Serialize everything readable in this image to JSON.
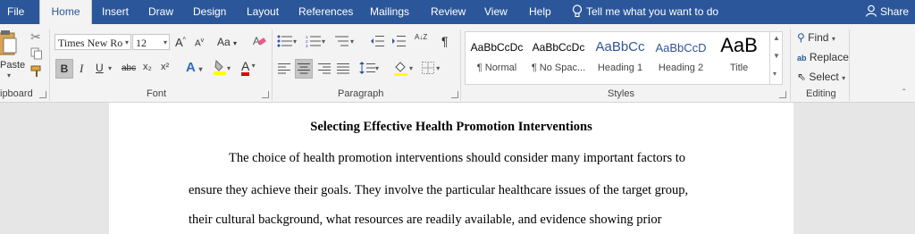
{
  "tabs": [
    "File",
    "Home",
    "Insert",
    "Draw",
    "Design",
    "Layout",
    "References",
    "Mailings",
    "Review",
    "View",
    "Help"
  ],
  "active_tab": "Home",
  "tell_me": "Tell me what you want to do",
  "share": "Share",
  "clipboard": {
    "paste": "Paste",
    "label": "ipboard"
  },
  "font": {
    "name": "Times New Ro",
    "size": "12",
    "label": "Font",
    "bold": "B",
    "italic": "I",
    "underline": "U",
    "strike": "abc",
    "sub": "x₂",
    "sup": "x²",
    "grow": "A",
    "shrink": "A",
    "case": "Aa",
    "effects": "A",
    "highlight": "ab",
    "color": "A"
  },
  "paragraph": {
    "label": "Paragraph",
    "sort": "A↓Z",
    "pilcrow": "¶"
  },
  "styles": {
    "label": "Styles",
    "items": [
      {
        "sample": "AaBbCcDc",
        "name": "¶ Normal"
      },
      {
        "sample": "AaBbCcDc",
        "name": "¶ No Spac..."
      },
      {
        "sample": "AaBbCc",
        "name": "Heading 1"
      },
      {
        "sample": "AaBbCcD",
        "name": "Heading 2"
      },
      {
        "sample": "AaB",
        "name": "Title"
      }
    ]
  },
  "editing": {
    "label": "Editing",
    "find": "Find",
    "replace": "Replace",
    "select": "Select"
  },
  "document": {
    "title": "Selecting Effective Health Promotion Interventions",
    "lines": [
      "The choice of health promotion interventions should consider many important factors to",
      "ensure they achieve their goals. They involve the particular healthcare issues of the target group,",
      "their cultural background, what resources are readily available, and evidence showing prior"
    ]
  },
  "colors": {
    "brand": "#2b579a",
    "ribbon": "#f3f3f3",
    "page": "#ffffff",
    "highlight_yellow": "#ffff00",
    "font_red": "#e00000",
    "heading_blue": "#2f5496"
  }
}
